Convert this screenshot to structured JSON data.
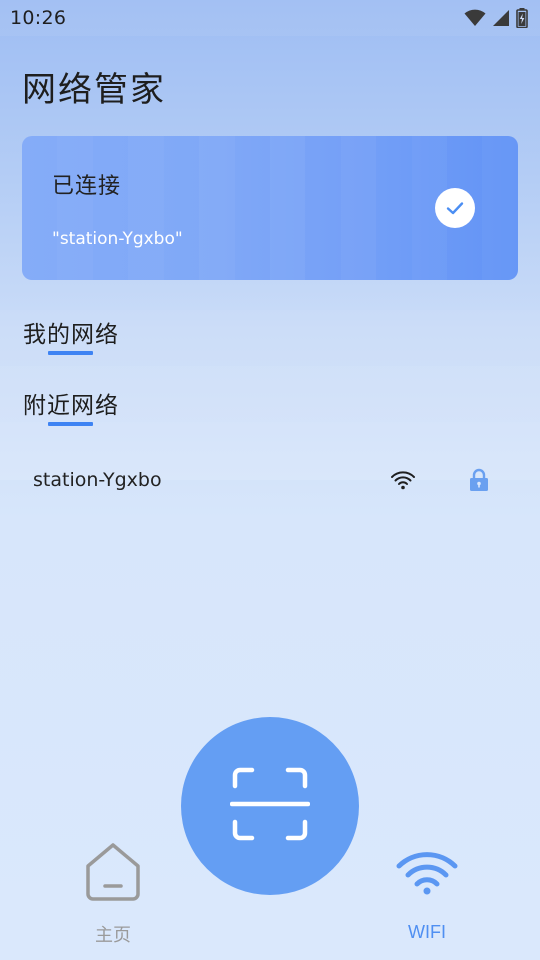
{
  "status_bar": {
    "time": "10:26",
    "icons": [
      "wifi-signal-icon",
      "cell-signal-icon",
      "battery-icon"
    ]
  },
  "header": {
    "title": "网络管家"
  },
  "connected_card": {
    "status_label": "已连接",
    "ssid": "\"station-Ygxbo\"",
    "icon": "check-icon"
  },
  "sections": {
    "my_networks": "我的网络",
    "nearby_networks": "附近网络"
  },
  "nearby": [
    {
      "ssid": "station-Ygxbo",
      "icons": [
        "wifi-signal-icon",
        "lock-icon"
      ]
    }
  ],
  "scan_button": {
    "icon": "scan-icon"
  },
  "bottom_nav": {
    "home_label": "主页",
    "wifi_label": "WIFI"
  },
  "colors": {
    "accent": "#3e83f3",
    "card": "#7ea7f7",
    "scan_button": "#649ef3",
    "nav_active": "#4f8ff2",
    "nav_inactive": "#9a9a9a"
  }
}
